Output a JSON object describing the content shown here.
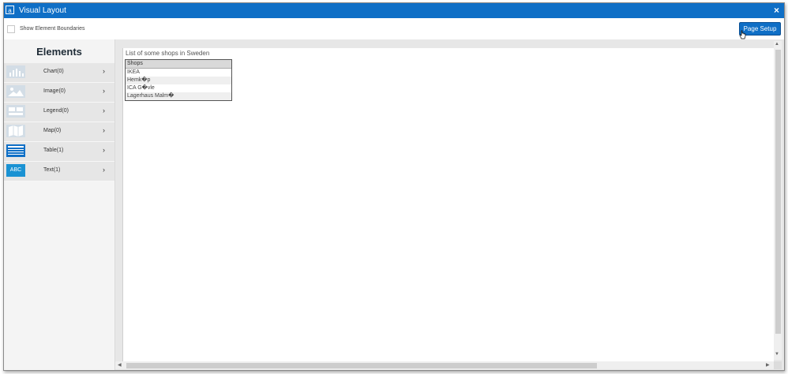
{
  "window": {
    "title": "Visual Layout",
    "app_icon": "a",
    "close_glyph": "×"
  },
  "toolbar": {
    "show_boundaries_label": "Show Element Boundaries",
    "show_boundaries_checked": false,
    "page_setup_label": "Page Setup"
  },
  "elements_panel": {
    "title": "Elements",
    "items": [
      {
        "label": "Chart(0)",
        "icon": "chart-icon",
        "active": false
      },
      {
        "label": "Image(0)",
        "icon": "image-icon",
        "active": false
      },
      {
        "label": "Legend(0)",
        "icon": "legend-icon",
        "active": false
      },
      {
        "label": "Map(0)",
        "icon": "map-icon",
        "active": false
      },
      {
        "label": "Table(1)",
        "icon": "table-icon",
        "active": true
      },
      {
        "label": "Text(1)",
        "icon": "text-abc-icon",
        "icon_text": "ABC",
        "active": true
      }
    ],
    "chevron": "›"
  },
  "canvas": {
    "caption": "List of some shops in Sweden",
    "table": {
      "header": "Shops",
      "rows": [
        "IKEA",
        "Hemk�p",
        "ICA G�vle",
        "Lagerhaus Malm�"
      ]
    }
  },
  "colors": {
    "accent": "#0f6fc6",
    "text_icon": "#1a92d3"
  }
}
